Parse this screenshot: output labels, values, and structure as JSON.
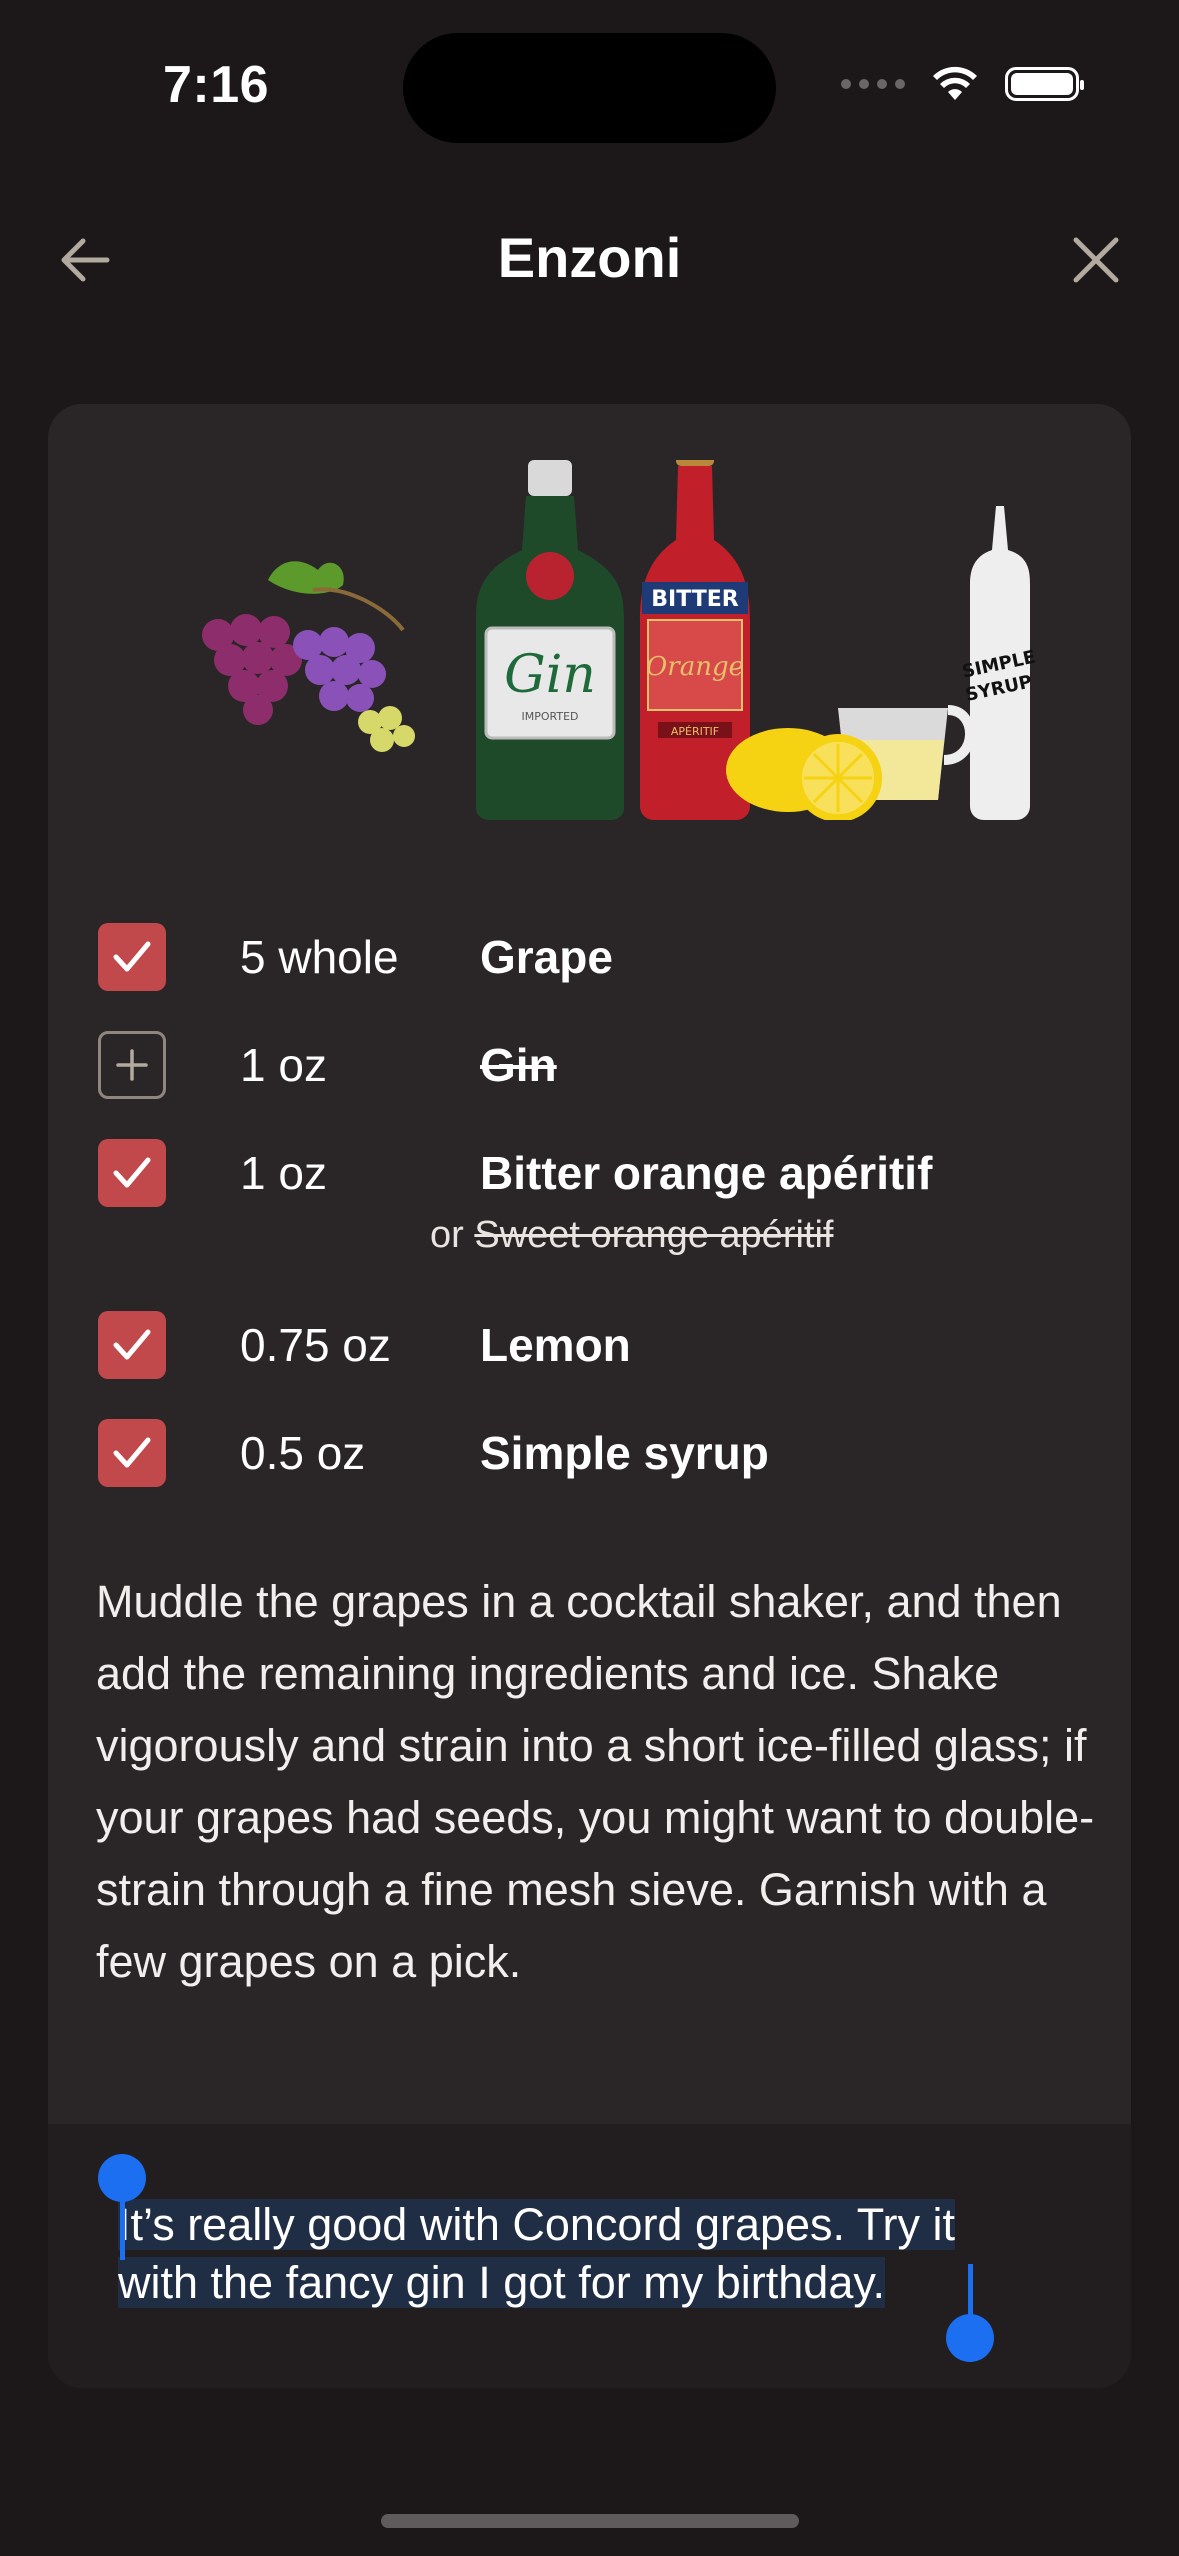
{
  "status_bar": {
    "time": "7:16"
  },
  "nav": {
    "title": "Enzoni",
    "back_icon": "arrow-left-icon",
    "close_icon": "close-icon"
  },
  "ingredients": [
    {
      "qty": "5 whole",
      "name": "Grape",
      "checked": true
    },
    {
      "qty": "1 oz",
      "name": "Gin",
      "checked": false,
      "struck": true
    },
    {
      "qty": "1 oz",
      "name": "Bitter orange apéritif",
      "checked": true,
      "alternative_prefix": "or",
      "alternative": "Sweet orange apéritif"
    },
    {
      "qty": "0.75 oz",
      "name": "Lemon",
      "checked": true
    },
    {
      "qty": "0.5 oz",
      "name": "Simple syrup",
      "checked": true
    }
  ],
  "illustration_labels": {
    "gin": "Gin",
    "gin_sub": "IMPORTED",
    "bitter": "BITTER",
    "orange": "Orange",
    "aperitif": "APÉRITIF",
    "syrup_1": "SIMPLE",
    "syrup_2": "SYRUP"
  },
  "instructions": "Muddle the grapes in a cocktail shaker, and then add the remaining ingredients and ice. Shake vigorously and strain into a short ice-filled glass; if your grapes had seeds, you might want to double-strain through a fine mesh sieve. Garnish with a few grapes on a pick.",
  "notes": {
    "line1": "It’s really good with Concord grapes. Try it",
    "line2": "with the fancy gin I got for my birthday."
  },
  "colors": {
    "background": "#1c1819",
    "card": "#2a2627",
    "checkbox_checked": "#c1484b",
    "selection": "#1b6ff0"
  }
}
